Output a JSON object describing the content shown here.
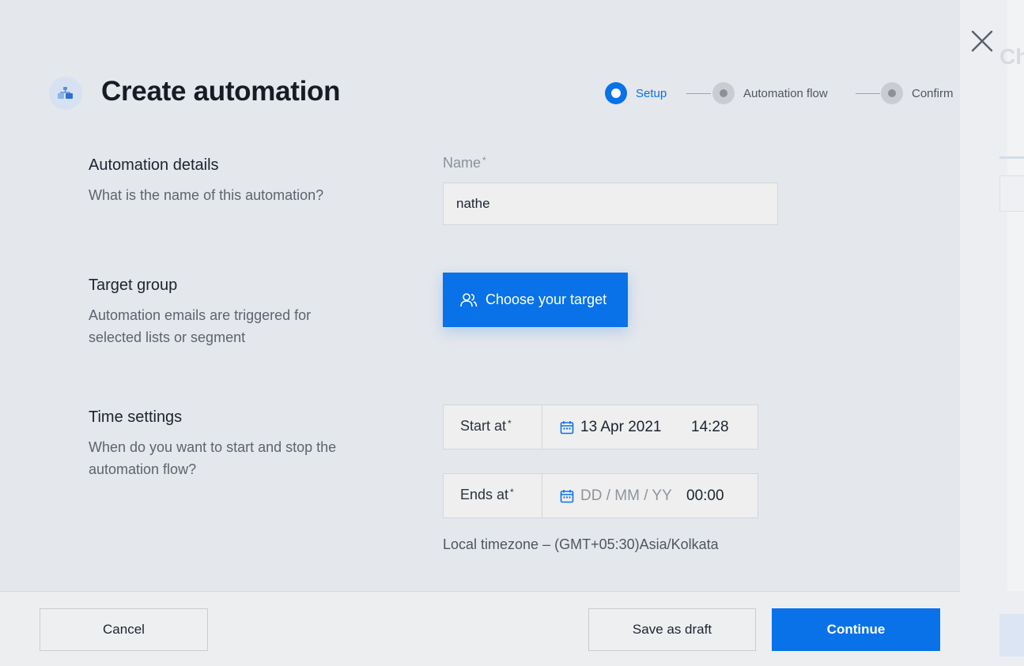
{
  "header": {
    "title": "Create automation",
    "icon": "automation-blocks-icon"
  },
  "stepper": {
    "steps": [
      {
        "label": "Setup",
        "state": "active"
      },
      {
        "label": "Automation flow",
        "state": "pending"
      },
      {
        "label": "Confirm",
        "state": "pending"
      }
    ]
  },
  "sections": {
    "details": {
      "title": "Automation details",
      "description": "What is the name of this automation?",
      "name_label": "Name",
      "required_mark": "*",
      "name_value": "nathe"
    },
    "target": {
      "title": "Target group",
      "description_line1": "Automation emails are triggered for",
      "description_line2": "selected lists or segment",
      "button_label": "Choose your target"
    },
    "time": {
      "title": "Time settings",
      "description_line1": "When do you want to start and stop the",
      "description_line2": "automation flow?",
      "start_label": "Start at",
      "start_date": "13 Apr 2021",
      "start_time": "14:28",
      "end_label": "Ends at",
      "end_date_placeholder": "DD / MM / YY",
      "end_time": "00:00",
      "required_mark": "*",
      "timezone": "Local timezone – (GMT+05:30)Asia/Kolkata"
    }
  },
  "footer": {
    "cancel_label": "Cancel",
    "draft_label": "Save as draft",
    "continue_label": "Continue"
  },
  "background_panel": {
    "title_fragment": "Ch"
  },
  "colors": {
    "accent": "#0a72e8",
    "background": "#e4e7ec"
  }
}
